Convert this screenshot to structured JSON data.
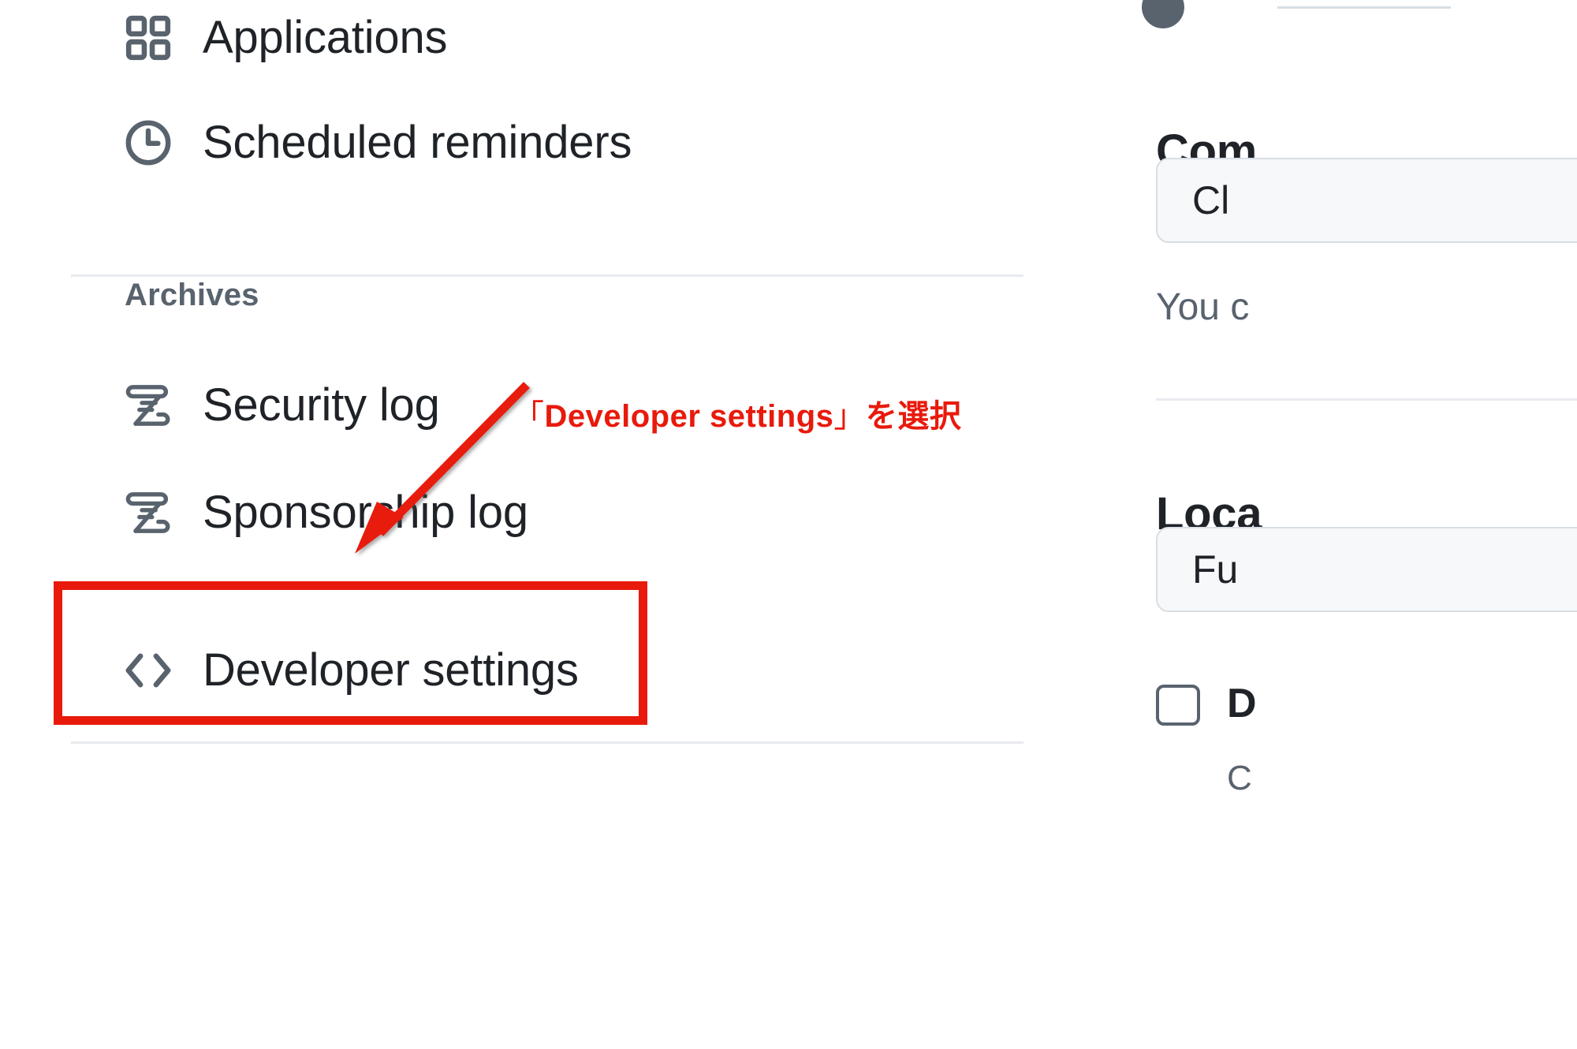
{
  "sidebar": {
    "items": [
      {
        "id": "applications",
        "label": "Applications",
        "icon": "apps-grid-icon"
      },
      {
        "id": "scheduled",
        "label": "Scheduled reminders",
        "icon": "clock-icon"
      },
      {
        "id": "security-log",
        "label": "Security log",
        "icon": "log-scroll-icon"
      },
      {
        "id": "sponsorship-log",
        "label": "Sponsorship log",
        "icon": "log-scroll-icon"
      },
      {
        "id": "developer",
        "label": "Developer settings",
        "icon": "code-brackets-icon"
      }
    ],
    "section_header": "Archives"
  },
  "annotation": {
    "open_bracket": "「",
    "target": "Developer settings",
    "close_bracket": "」",
    "suffix": "を選択",
    "full_text": "「Developer settings」を選択",
    "color": "#e81a0c",
    "outline_color": "#ffffff",
    "arrow": "red-arrow-down-left",
    "highlight_color": "#e81a0c"
  },
  "main": {
    "compose_heading": "Com",
    "compose_button": "Cl",
    "compose_help": "You c",
    "locale_heading": "Loca",
    "locale_button": "Fu",
    "checkbox_label": "D",
    "checkbox_sub": "C"
  },
  "colors": {
    "text": "#1f2328",
    "muted": "#59636e",
    "icon": "#59636e",
    "divider": "#e8ebef",
    "accent_red": "#e81a0c",
    "button_bg": "#f6f8fa",
    "button_border": "#d8dee4",
    "background": "#ffffff"
  }
}
